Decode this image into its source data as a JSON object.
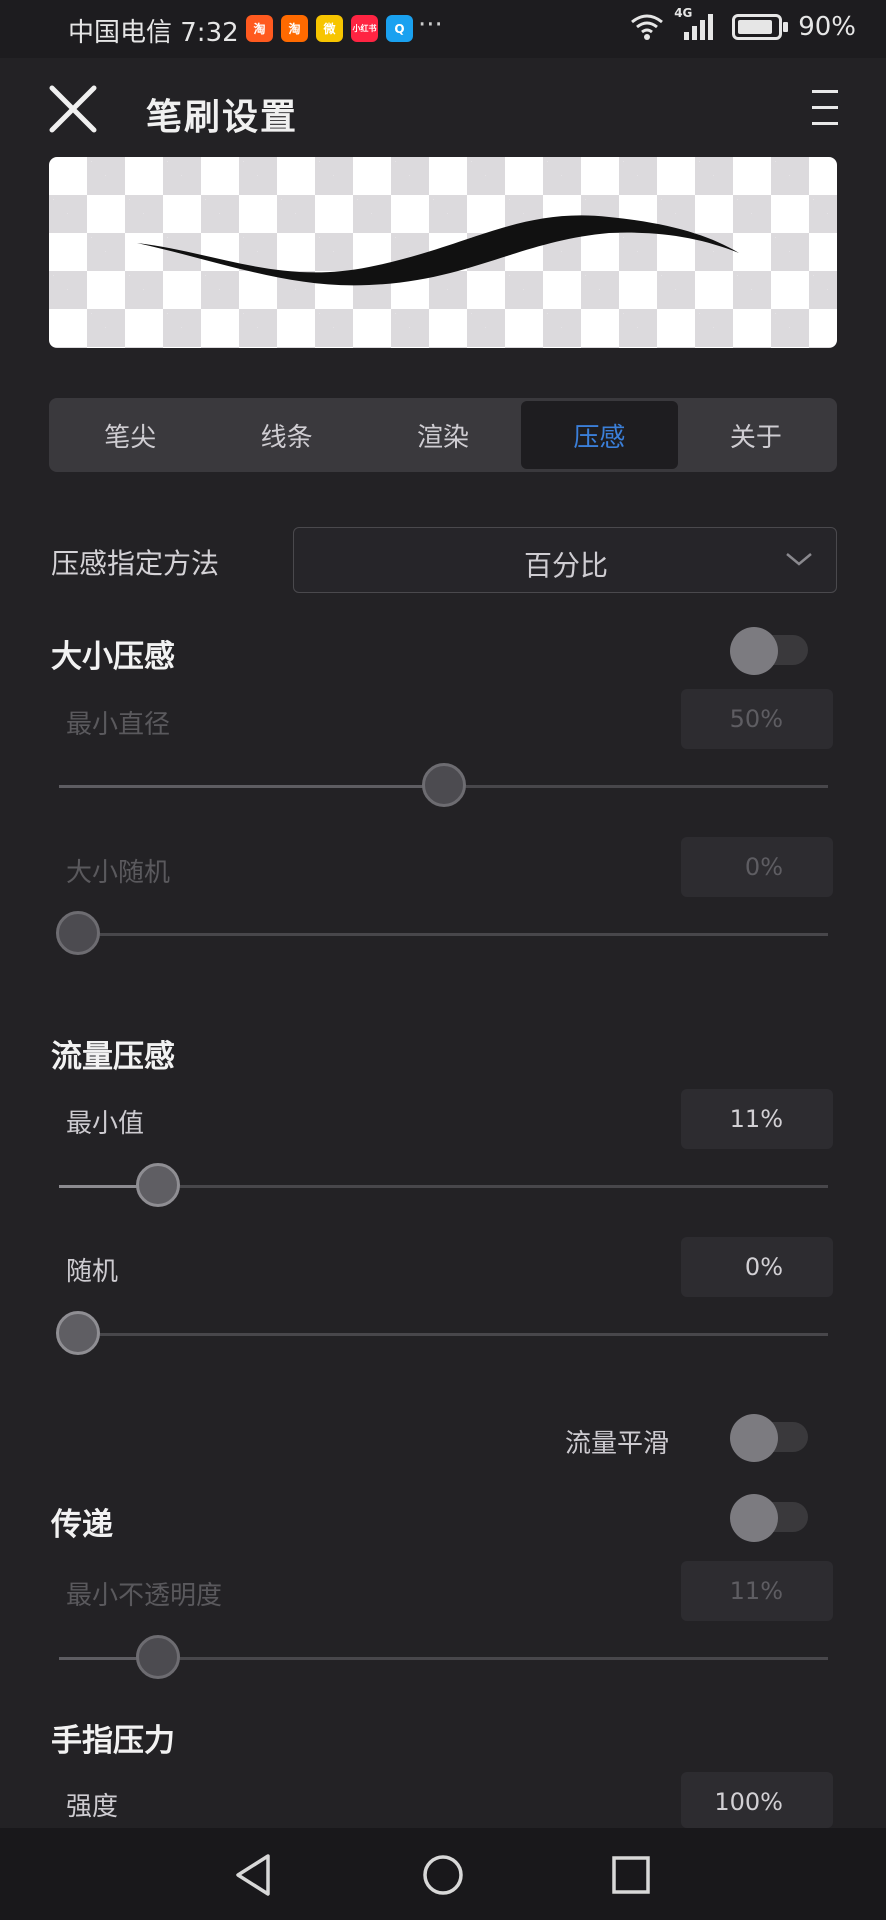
{
  "status_bar": {
    "carrier_time": "中国电信 7:32",
    "apps": [
      {
        "name": "taobao-app-icon",
        "text": "淘",
        "color": "#ff5a1f"
      },
      {
        "name": "taobao-special-app-icon",
        "text": "淘",
        "color": "#ff6a00"
      },
      {
        "name": "weibo-app-icon",
        "text": "微",
        "color": "#f7c500"
      },
      {
        "name": "xiaohongshu-app-icon",
        "text": "小红书",
        "color": "#ff2442"
      },
      {
        "name": "search-app-icon",
        "text": "Q",
        "color": "#1aa1f0"
      }
    ],
    "more": "···",
    "network": "4G",
    "battery": "90%",
    "battery_level": 0.9
  },
  "header": {
    "title": "笔刷设置",
    "close_icon": "close-icon",
    "menu_icon": "menu-icon"
  },
  "tabs": [
    {
      "label": "笔尖",
      "active": false
    },
    {
      "label": "线条",
      "active": false
    },
    {
      "label": "渲染",
      "active": false
    },
    {
      "label": "压感",
      "active": true
    },
    {
      "label": "关于",
      "active": false
    }
  ],
  "pressure_method": {
    "label": "压感指定方法",
    "value": "百分比"
  },
  "size_pressure": {
    "title": "大小压感",
    "enabled": false,
    "min_diameter": {
      "label": "最小直径",
      "value": "50%",
      "fraction": 0.5
    },
    "size_random": {
      "label": "大小随机",
      "value": "0%",
      "fraction": 0.0
    }
  },
  "flow_pressure": {
    "title": "流量压感",
    "min_value": {
      "label": "最小值",
      "value": "11%",
      "fraction": 0.11
    },
    "random": {
      "label": "随机",
      "value": "0%",
      "fraction": 0.0
    },
    "flow_smooth": {
      "label": "流量平滑",
      "enabled": false
    }
  },
  "transfer": {
    "title": "传递",
    "enabled": false,
    "min_opacity": {
      "label": "最小不透明度",
      "value": "11%",
      "fraction": 0.11
    }
  },
  "finger_pressure": {
    "title": "手指压力",
    "strength": {
      "label": "强度",
      "value": "100%"
    }
  },
  "navbar": {
    "back_icon": "back-triangle-icon",
    "home_icon": "home-circle-icon",
    "recents_icon": "recents-square-icon"
  }
}
